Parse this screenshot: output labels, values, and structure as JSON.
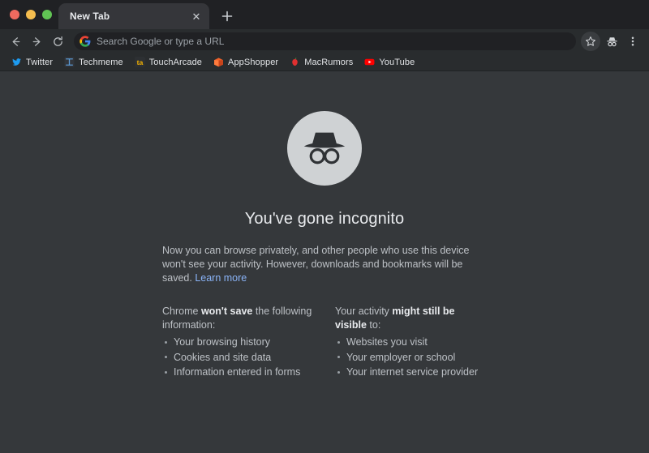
{
  "window": {
    "traffic_lights": [
      {
        "name": "close",
        "color": "#ee6a5f"
      },
      {
        "name": "minimize",
        "color": "#f5bd4f"
      },
      {
        "name": "maximize",
        "color": "#61c454"
      }
    ]
  },
  "tabstrip": {
    "tabs": [
      {
        "title": "New Tab",
        "close_glyph": "✕"
      }
    ],
    "new_tab_label": "+"
  },
  "toolbar": {
    "back_label": "←",
    "forward_label": "→",
    "reload_label": "↻",
    "omnibox": {
      "placeholder": "Search Google or type a URL",
      "value": "",
      "icon": "google-g-icon"
    },
    "bookmark_star_icon": "star-icon",
    "incognito_indicator_icon": "incognito-icon",
    "menu_icon": "three-dot-menu-icon"
  },
  "bookmarks_bar": {
    "items": [
      {
        "label": "Twitter",
        "icon": "twitter-bird-icon",
        "color": "#1d9bf0"
      },
      {
        "label": "Techmeme",
        "icon": "techmeme-icon",
        "color": "#4c8fd0"
      },
      {
        "label": "TouchArcade",
        "icon": "toucharcade-icon",
        "color": "#f5b300"
      },
      {
        "label": "AppShopper",
        "icon": "appshopper-icon",
        "color": "#f0622a"
      },
      {
        "label": "MacRumors",
        "icon": "macrumors-apple-icon",
        "color": "#e03030"
      },
      {
        "label": "YouTube",
        "icon": "youtube-icon",
        "color": "#ff0000"
      }
    ]
  },
  "page": {
    "icon": "incognito-hat-glasses-icon",
    "headline": "You've gone incognito",
    "intro_text": "Now you can browse privately, and other people who use this device won't see your activity. However, downloads and bookmarks will be saved. ",
    "learn_more_label": "Learn more",
    "columns": [
      {
        "head_prefix": "Chrome ",
        "head_bold": "won't save",
        "head_suffix": " the following information:",
        "items": [
          "Your browsing history",
          "Cookies and site data",
          "Information entered in forms"
        ]
      },
      {
        "head_prefix": "Your activity ",
        "head_bold": "might still be visible",
        "head_suffix": " to:",
        "items": [
          "Websites you visit",
          "Your employer or school",
          "Your internet service provider"
        ]
      }
    ]
  },
  "colors": {
    "page_bg": "#35383b",
    "toolbar_bg": "#292c2e",
    "tabstrip_bg": "#202124",
    "active_tab_bg": "#35363a",
    "omnibox_bg": "#202124",
    "text_primary": "#e8eaed",
    "text_secondary": "#bdc1c6",
    "link": "#8ab4f8",
    "incognito_circle": "#cfd2d4"
  }
}
